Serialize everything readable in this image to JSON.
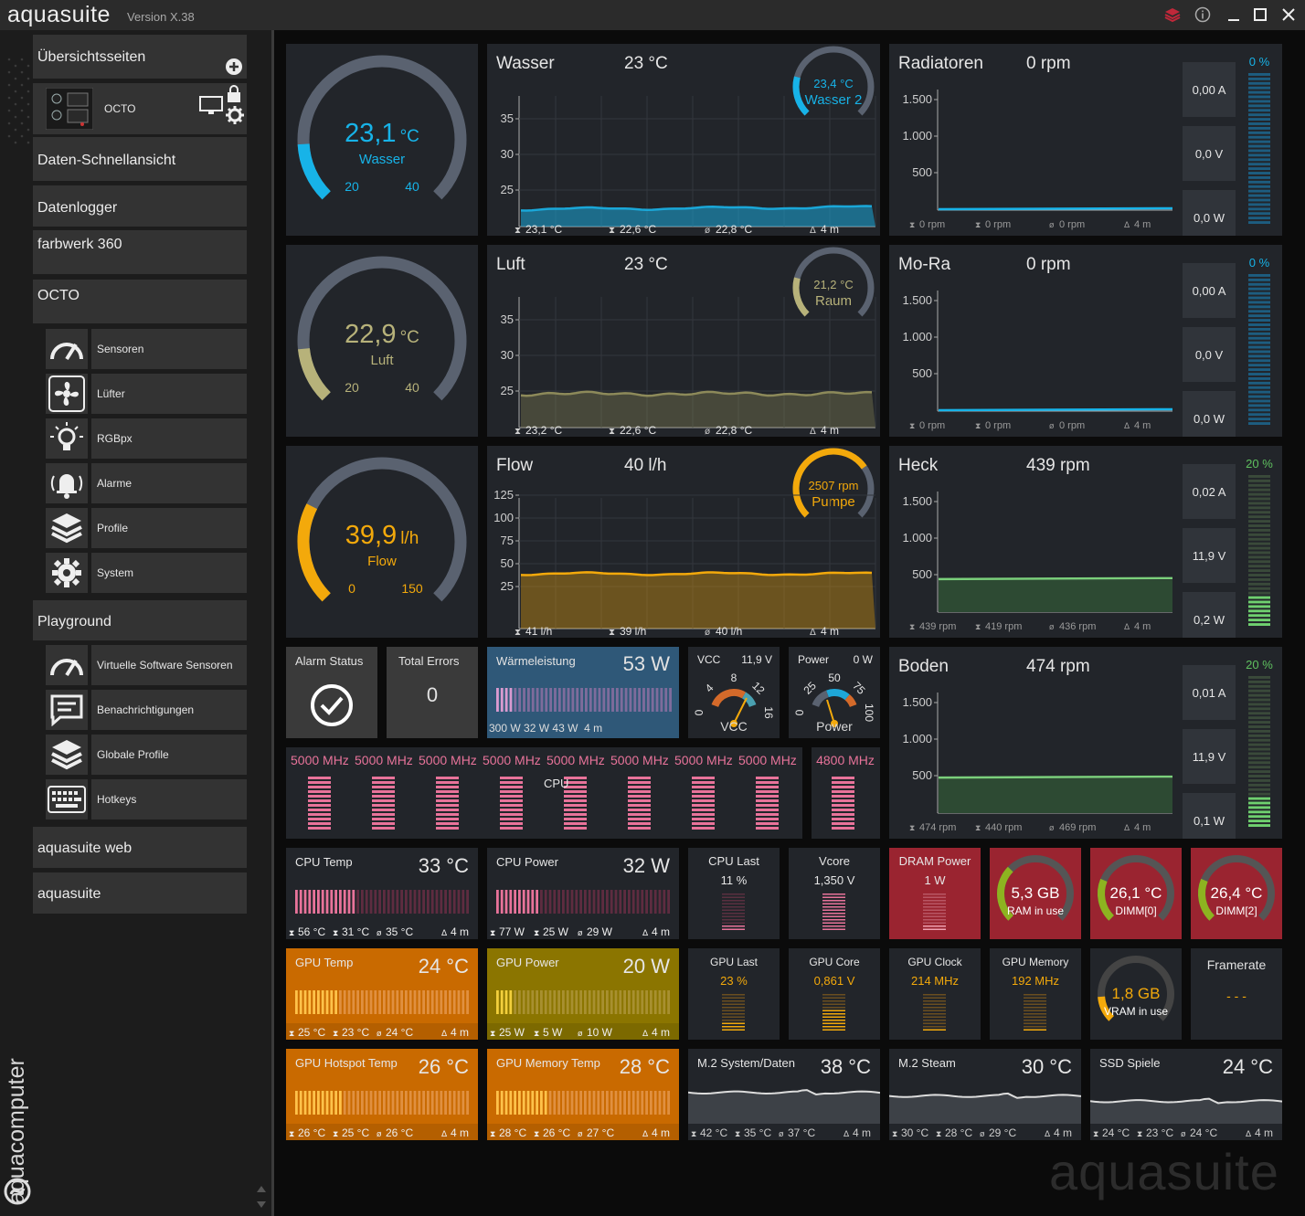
{
  "app": {
    "name": "aquasuite",
    "version": "Version X.38"
  },
  "window_controls": [
    "layers-icon",
    "info-icon",
    "minimize-icon",
    "maximize-icon",
    "close-icon"
  ],
  "sidebar": {
    "overview": "Übersichtsseiten",
    "device_name": "OCTO",
    "data_quickview": "Daten-Schnellansicht",
    "datalogger": "Datenlogger",
    "farbwerk": "farbwerk 360",
    "octo": "OCTO",
    "octo_items": [
      "Sensoren",
      "Lüfter",
      "RGBpx",
      "Alarme",
      "Profile",
      "System"
    ],
    "playground": "Playground",
    "playground_items": [
      "Virtuelle Software Sensoren",
      "Benachrichtigungen",
      "Globale Profile",
      "Hotkeys"
    ],
    "aquasuite_web": "aquasuite web",
    "aquasuite": "aquasuite",
    "brand": "aquacomputer"
  },
  "gauges": [
    {
      "value": "23,1",
      "unit": "°C",
      "label": "Wasser",
      "min": "20",
      "max": "40",
      "color": "#17b3e8",
      "level": 0.155
    },
    {
      "value": "22,9",
      "unit": "°C",
      "label": "Luft",
      "min": "20",
      "max": "40",
      "color": "#b7b27a",
      "level": 0.145
    },
    {
      "value": "39,9",
      "unit": "l/h",
      "label": "Flow",
      "min": "0",
      "max": "150",
      "color": "#f3a90b",
      "level": 0.266
    }
  ],
  "charts": [
    {
      "title": "Wasser",
      "value": "23 °C",
      "mini_value": "23,4 °C",
      "mini_label": "Wasser 2",
      "mini_color": "#17b3e8",
      "y_ticks": [
        "35",
        "30",
        "25"
      ],
      "stats": [
        "23,1 °C",
        "22,6 °C",
        "22,8 °C",
        "4 m"
      ],
      "line_color": "#1aa7d8"
    },
    {
      "title": "Luft",
      "value": "23 °C",
      "mini_value": "21,2 °C",
      "mini_label": "Raum",
      "mini_color": "#b7b27a",
      "y_ticks": [
        "35",
        "30",
        "25"
      ],
      "stats": [
        "23,2 °C",
        "22,6 °C",
        "22,8 °C",
        "4 m"
      ],
      "line_color": "#8d8a5a"
    },
    {
      "title": "Flow",
      "value": "40 l/h",
      "mini_value": "2507 rpm",
      "mini_label": "Pumpe",
      "mini_color": "#f3a90b",
      "y_ticks": [
        "125",
        "100",
        "75",
        "50",
        "25"
      ],
      "stats": [
        "41 l/h",
        "39 l/h",
        "40 l/h",
        "4 m"
      ],
      "line_color": "#f3a90b"
    }
  ],
  "fans": [
    {
      "title": "Radiatoren",
      "value": "0 rpm",
      "y_ticks": [
        "1.500",
        "1.000",
        "500"
      ],
      "stats": [
        "0 rpm",
        "0 rpm",
        "0 rpm",
        "4 m"
      ],
      "current": "0,00 A",
      "voltage": "0,0 V",
      "power": "0,0 W",
      "pct": "0 %",
      "pct_color": "#17b3e8",
      "bar_color": "#1a6e95"
    },
    {
      "title": "Mo-Ra",
      "value": "0 rpm",
      "y_ticks": [
        "1.500",
        "1.000",
        "500"
      ],
      "stats": [
        "0 rpm",
        "0 rpm",
        "0 rpm",
        "4 m"
      ],
      "current": "0,00 A",
      "voltage": "0,0 V",
      "power": "0,0 W",
      "pct": "0 %",
      "pct_color": "#17b3e8",
      "bar_color": "#1a6e95"
    },
    {
      "title": "Heck",
      "value": "439 rpm",
      "y_ticks": [
        "1.500",
        "1.000",
        "500"
      ],
      "stats": [
        "439 rpm",
        "419 rpm",
        "436 rpm",
        "4 m"
      ],
      "current": "0,02 A",
      "voltage": "11,9 V",
      "power": "0,2 W",
      "pct": "20 %",
      "pct_color": "#5fc05f",
      "bar_color": "#5fc05f"
    },
    {
      "title": "Boden",
      "value": "474 rpm",
      "y_ticks": [
        "1.500",
        "1.000",
        "500"
      ],
      "stats": [
        "474 rpm",
        "440 rpm",
        "469 rpm",
        "4 m"
      ],
      "current": "0,01 A",
      "voltage": "11,9 V",
      "power": "0,1 W",
      "pct": "20 %",
      "pct_color": "#5fc05f",
      "bar_color": "#5fc05f"
    }
  ],
  "alarm": {
    "title": "Alarm Status"
  },
  "errors": {
    "title": "Total Errors",
    "value": "0"
  },
  "heat": {
    "title": "Wärmeleistung",
    "value": "53 W",
    "stats": [
      "300 W",
      "32 W",
      "43 W",
      "4 m"
    ]
  },
  "vcc": {
    "title": "VCC",
    "value": "11,9 V",
    "ticks": [
      "0",
      "4",
      "8",
      "12",
      "16"
    ],
    "label": "VCC"
  },
  "power_gauge": {
    "title": "Power",
    "value": "0 W",
    "ticks": [
      "0",
      "25",
      "50",
      "75",
      "100"
    ],
    "label": "Power"
  },
  "cpu": {
    "label": "CPU",
    "cores": [
      "5000 MHz",
      "5000 MHz",
      "5000 MHz",
      "5000 MHz",
      "5000 MHz",
      "5000 MHz",
      "5000 MHz",
      "5000 MHz"
    ],
    "extra": "4800 MHz"
  },
  "row_cpu": {
    "cpu_temp": {
      "title": "CPU Temp",
      "value": "33 °C",
      "stats": [
        "56 °C",
        "31 °C",
        "35 °C",
        "4 m"
      ]
    },
    "cpu_power": {
      "title": "CPU Power",
      "value": "32 W",
      "stats": [
        "77 W",
        "25 W",
        "29 W",
        "4 m"
      ]
    },
    "cpu_load": {
      "title": "CPU Last",
      "value": "11 %"
    },
    "vcore": {
      "title": "Vcore",
      "value": "1,350 V"
    },
    "dram_power": {
      "title": "DRAM Power",
      "value": "1 W"
    },
    "ram": {
      "value": "5,3 GB",
      "label": "RAM in use"
    },
    "dimm0": {
      "value": "26,1 °C",
      "label": "DIMM[0]"
    },
    "dimm2": {
      "value": "26,4 °C",
      "label": "DIMM[2]"
    }
  },
  "row_gpu": {
    "gpu_temp": {
      "title": "GPU Temp",
      "value": "24 °C",
      "stats": [
        "25 °C",
        "23 °C",
        "24 °C",
        "4 m"
      ]
    },
    "gpu_power": {
      "title": "GPU Power",
      "value": "20 W",
      "stats": [
        "25 W",
        "5 W",
        "10 W",
        "4 m"
      ]
    },
    "gpu_load": {
      "title": "GPU Last",
      "value": "23 %"
    },
    "gpu_core": {
      "title": "GPU Core",
      "value": "0,861 V"
    },
    "gpu_clock": {
      "title": "GPU Clock",
      "value": "214 MHz"
    },
    "gpu_memory": {
      "title": "GPU Memory",
      "value": "192 MHz"
    },
    "vram": {
      "value": "1,8 GB",
      "label": "VRAM in use"
    },
    "framerate": {
      "title": "Framerate",
      "value": "- - -"
    }
  },
  "row_storage": {
    "hotspot": {
      "title": "GPU Hotspot Temp",
      "value": "26 °C",
      "stats": [
        "26 °C",
        "25 °C",
        "26 °C",
        "4 m"
      ]
    },
    "memtemp": {
      "title": "GPU Memory Temp",
      "value": "28 °C",
      "stats": [
        "28 °C",
        "26 °C",
        "27 °C",
        "4 m"
      ]
    },
    "m2sys": {
      "title": "M.2 System/Daten",
      "value": "38 °C",
      "stats": [
        "42 °C",
        "35 °C",
        "37 °C",
        "4 m"
      ]
    },
    "m2steam": {
      "title": "M.2 Steam",
      "value": "30 °C",
      "stats": [
        "30 °C",
        "28 °C",
        "29 °C",
        "4 m"
      ]
    },
    "ssd": {
      "title": "SSD Spiele",
      "value": "24 °C",
      "stats": [
        "24 °C",
        "23 °C",
        "24 °C",
        "4 m"
      ]
    }
  },
  "watermark": "aquasuite",
  "colors": {
    "orange": "#c96a00",
    "olive": "#8b7500",
    "red": "#9a2430",
    "blue_tile": "#2f5878",
    "pink": "#e8739a",
    "amber": "#f3a90b"
  }
}
